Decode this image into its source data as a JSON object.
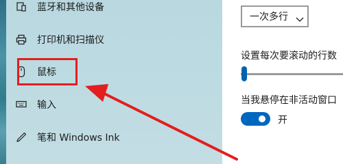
{
  "sidebar": {
    "items": [
      {
        "label": "蓝牙和其他设备",
        "icon": "bluetooth-device-icon"
      },
      {
        "label": "打印机和扫描仪",
        "icon": "printer-icon"
      },
      {
        "label": "鼠标",
        "icon": "mouse-icon"
      },
      {
        "label": "输入",
        "icon": "keyboard-icon"
      },
      {
        "label": "笔和 Windows Ink",
        "icon": "pen-icon"
      }
    ],
    "highlighted_item": "鼠标"
  },
  "main": {
    "scroll_mode_dropdown": {
      "value": "一次多行"
    },
    "scroll_lines_label": "设置每次要滚动的行数",
    "scroll_lines_slider": {
      "level_fraction": 0.03
    },
    "inactive_scroll_label": "当我悬停在非活动窗口",
    "inactive_scroll_toggle": {
      "state": "开",
      "on": true
    }
  },
  "annotation": {
    "color": "#e21e1e"
  },
  "colors": {
    "accent": "#0067c0",
    "sidebar_bg": "#bddbe2"
  }
}
